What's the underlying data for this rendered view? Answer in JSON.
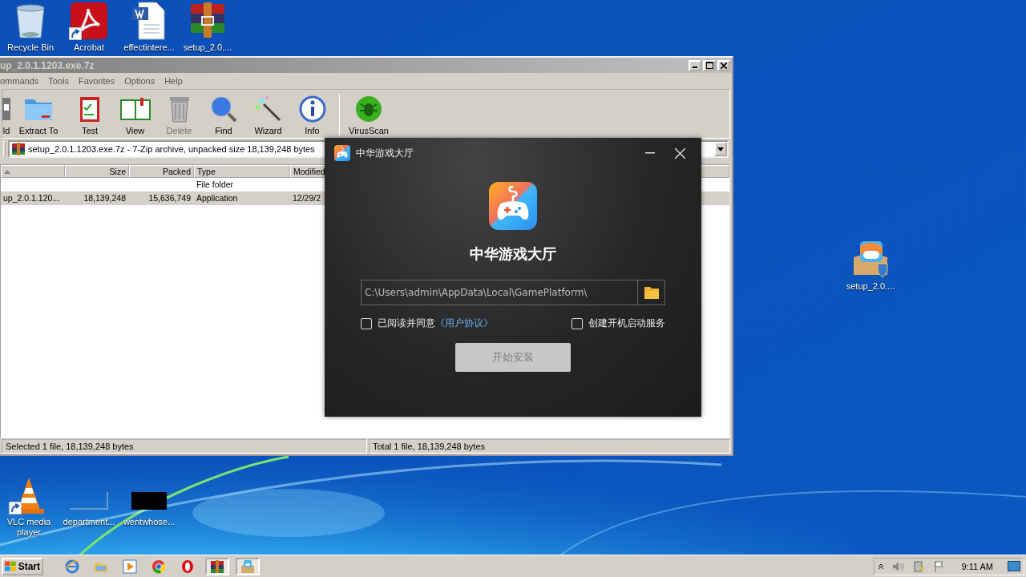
{
  "desktop": {
    "icons": [
      {
        "label": "Recycle Bin",
        "kind": "recycle-bin",
        "shortcut": false
      },
      {
        "label": "Acrobat",
        "kind": "pdf",
        "shortcut": true
      },
      {
        "label": "effectintere...",
        "kind": "word",
        "shortcut": false
      },
      {
        "label": "setup_2.0....",
        "kind": "archive",
        "shortcut": false
      },
      {
        "label": "setup_2.0....",
        "kind": "installer",
        "shortcut": false
      },
      {
        "label": "VLC media player",
        "kind": "vlc",
        "shortcut": true
      },
      {
        "label": "department...",
        "kind": "blank",
        "shortcut": false
      },
      {
        "label": "wentwhose...",
        "kind": "black",
        "shortcut": false
      }
    ]
  },
  "archiver": {
    "title": "up_2.0.1.1203.exe.7z",
    "menu": [
      "ommands",
      "Tools",
      "Favorites",
      "Options",
      "Help"
    ],
    "toolbar": [
      {
        "label": "ld",
        "kind": "add",
        "disabled": false
      },
      {
        "label": "Extract To",
        "kind": "extract",
        "disabled": false
      },
      {
        "label": "Test",
        "kind": "test",
        "disabled": false
      },
      {
        "label": "View",
        "kind": "view",
        "disabled": false
      },
      {
        "label": "Delete",
        "kind": "delete",
        "disabled": true
      },
      {
        "label": "Find",
        "kind": "find",
        "disabled": false
      },
      {
        "label": "Wizard",
        "kind": "wizard",
        "disabled": false
      },
      {
        "label": "Info",
        "kind": "info",
        "disabled": false
      },
      {
        "label": "VirusScan",
        "kind": "virus",
        "disabled": false
      }
    ],
    "address": "setup_2.0.1.1203.exe.7z - 7-Zip archive, unpacked size 18,139,248 bytes",
    "columns": [
      "Size",
      "Packed",
      "Type",
      "Modified"
    ],
    "rows": [
      {
        "name": "",
        "size": "",
        "packed": "",
        "type": "File folder",
        "modified": "",
        "selected": false
      },
      {
        "name": "up_2.0.1.120...",
        "size": "18,139,248",
        "packed": "15,636,749",
        "type": "Application",
        "modified": "12/29/2",
        "selected": true
      }
    ],
    "status": [
      "Selected 1 file, 18,139,248 bytes",
      "Total 1 file, 18,139,248 bytes"
    ]
  },
  "installer": {
    "title": "中华游戏大厅",
    "heading": "中华游戏大厅",
    "path": "C:\\Users\\admin\\AppData\\Local\\GamePlatform\\",
    "agree": {
      "label": "已阅读并同意",
      "link": "《用户协议》",
      "checked": false
    },
    "autostart": {
      "label": "创建开机启动服务",
      "checked": false
    },
    "install_button": {
      "label": "开始安装",
      "disabled": true
    }
  },
  "taskbar": {
    "start": "Start",
    "items": [
      {
        "kind": "ie",
        "active": false
      },
      {
        "kind": "explorer",
        "active": false
      },
      {
        "kind": "media",
        "active": false
      },
      {
        "kind": "chrome",
        "active": false
      },
      {
        "kind": "opera",
        "active": false
      },
      {
        "kind": "archive",
        "active": true
      },
      {
        "kind": "installer",
        "active": true
      }
    ],
    "clock": "9:11 AM"
  }
}
